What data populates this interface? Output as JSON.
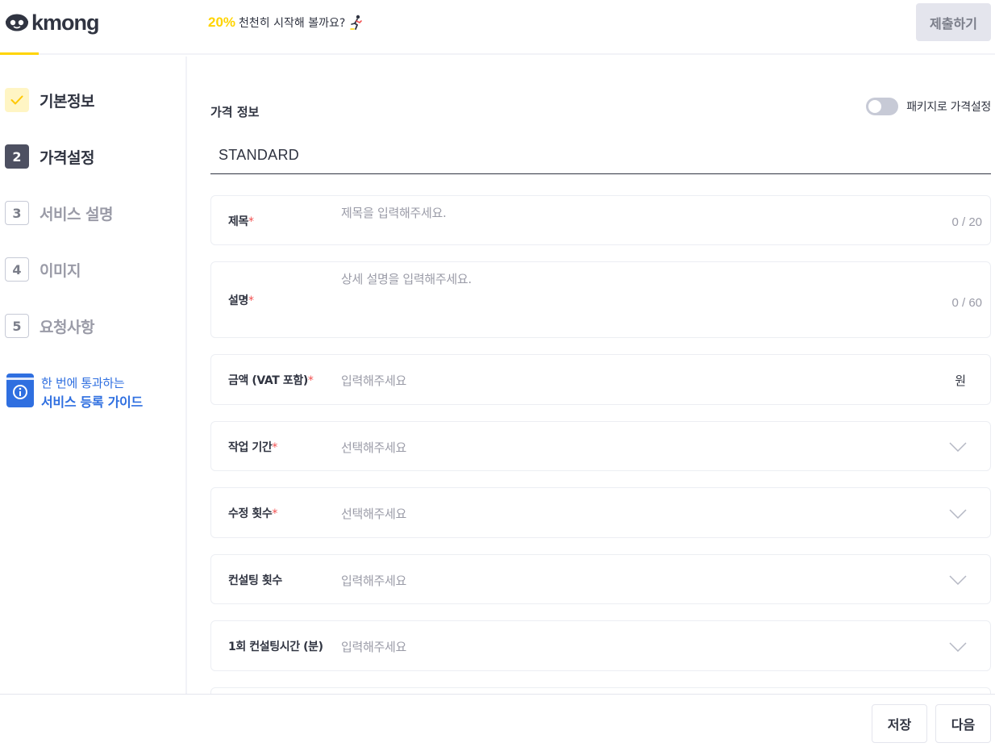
{
  "header": {
    "logo_text": "kmong",
    "progress_percent": "20%",
    "progress_message": "천천히 시작해 볼까요?",
    "submit_label": "제출하기"
  },
  "sidebar": {
    "steps": [
      {
        "number": "✓",
        "label": "기본정보",
        "state": "done"
      },
      {
        "number": "2",
        "label": "가격설정",
        "state": "active"
      },
      {
        "number": "3",
        "label": "서비스 설명",
        "state": "todo"
      },
      {
        "number": "4",
        "label": "이미지",
        "state": "todo"
      },
      {
        "number": "5",
        "label": "요청사항",
        "state": "todo"
      }
    ],
    "guide": {
      "line1": "한 번에 통과하는",
      "line2": "서비스 등록 가이드"
    }
  },
  "main": {
    "section_title": "가격 정보",
    "package_toggle_label": "패키지로 가격설정",
    "package_toggle_on": false,
    "package_tab": "STANDARD",
    "fields": [
      {
        "label": "제목",
        "required": "*",
        "placeholder": "제목을 입력해주세요.",
        "counter": "0 / 20"
      },
      {
        "label": "설명",
        "required": "*",
        "placeholder": "상세 설명을 입력해주세요.",
        "counter": "0 / 60"
      },
      {
        "label": "금액 (VAT 포함)",
        "required": "*",
        "placeholder": "입력해주세요",
        "unit": "원"
      },
      {
        "label": "작업 기간",
        "required": "*",
        "placeholder": "선택해주세요"
      },
      {
        "label": "수정 횟수",
        "required": "*",
        "placeholder": "선택해주세요"
      },
      {
        "label": "컨설팅 횟수",
        "required": "",
        "placeholder": "입력해주세요"
      },
      {
        "label": "1회 컨설팅시간 (분)",
        "required": "",
        "placeholder": "입력해주세요"
      }
    ]
  },
  "footer": {
    "save_label": "저장",
    "next_label": "다음"
  },
  "colors": {
    "brand_yellow": "#ffd400",
    "text_dark": "#303441",
    "placeholder_gray": "#9a9ba7",
    "required_red": "#f25050",
    "guide_blue": "#2f6fe0"
  }
}
